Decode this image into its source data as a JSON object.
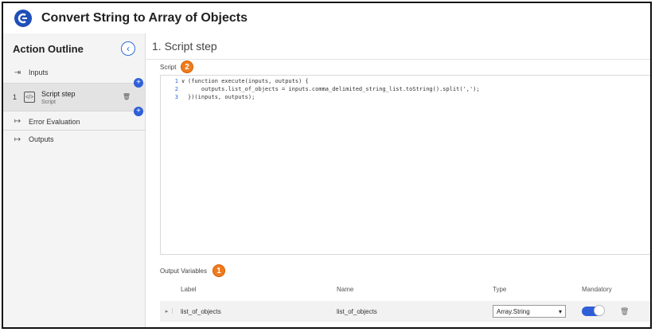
{
  "app": {
    "title": "Convert String to Array of Objects"
  },
  "outline": {
    "title": "Action Outline",
    "items": [
      {
        "label": "Inputs",
        "icon": "input-arrow-icon"
      },
      {
        "number": "1",
        "label": "Script step",
        "sublabel": "Script",
        "icon": "script-icon"
      },
      {
        "label": "Error Evaluation",
        "icon": "output-arrow-icon"
      },
      {
        "label": "Outputs",
        "icon": "output-arrow-icon"
      }
    ]
  },
  "main": {
    "step_title": "1.  Script step",
    "script_label": "Script",
    "badges": {
      "script": "2",
      "output": "1"
    },
    "code": [
      {
        "n": "1",
        "fold": "∨",
        "text": "(function execute(inputs, outputs) {"
      },
      {
        "n": "2",
        "fold": "",
        "text": "    outputs.list_of_objects = inputs.comma_delimited_string_list.toString().split(',');"
      },
      {
        "n": "3",
        "fold": "",
        "text": "})(inputs, outputs);"
      }
    ],
    "output_variables": {
      "title": "Output Variables",
      "headers": {
        "label": "Label",
        "name": "Name",
        "type": "Type",
        "mandatory": "Mandatory"
      },
      "rows": [
        {
          "label": "list_of_objects",
          "name": "list_of_objects",
          "type": "Array.String",
          "mandatory": true
        }
      ]
    }
  },
  "colors": {
    "accent": "#2f5fd8",
    "badge": "#f07b1d"
  }
}
